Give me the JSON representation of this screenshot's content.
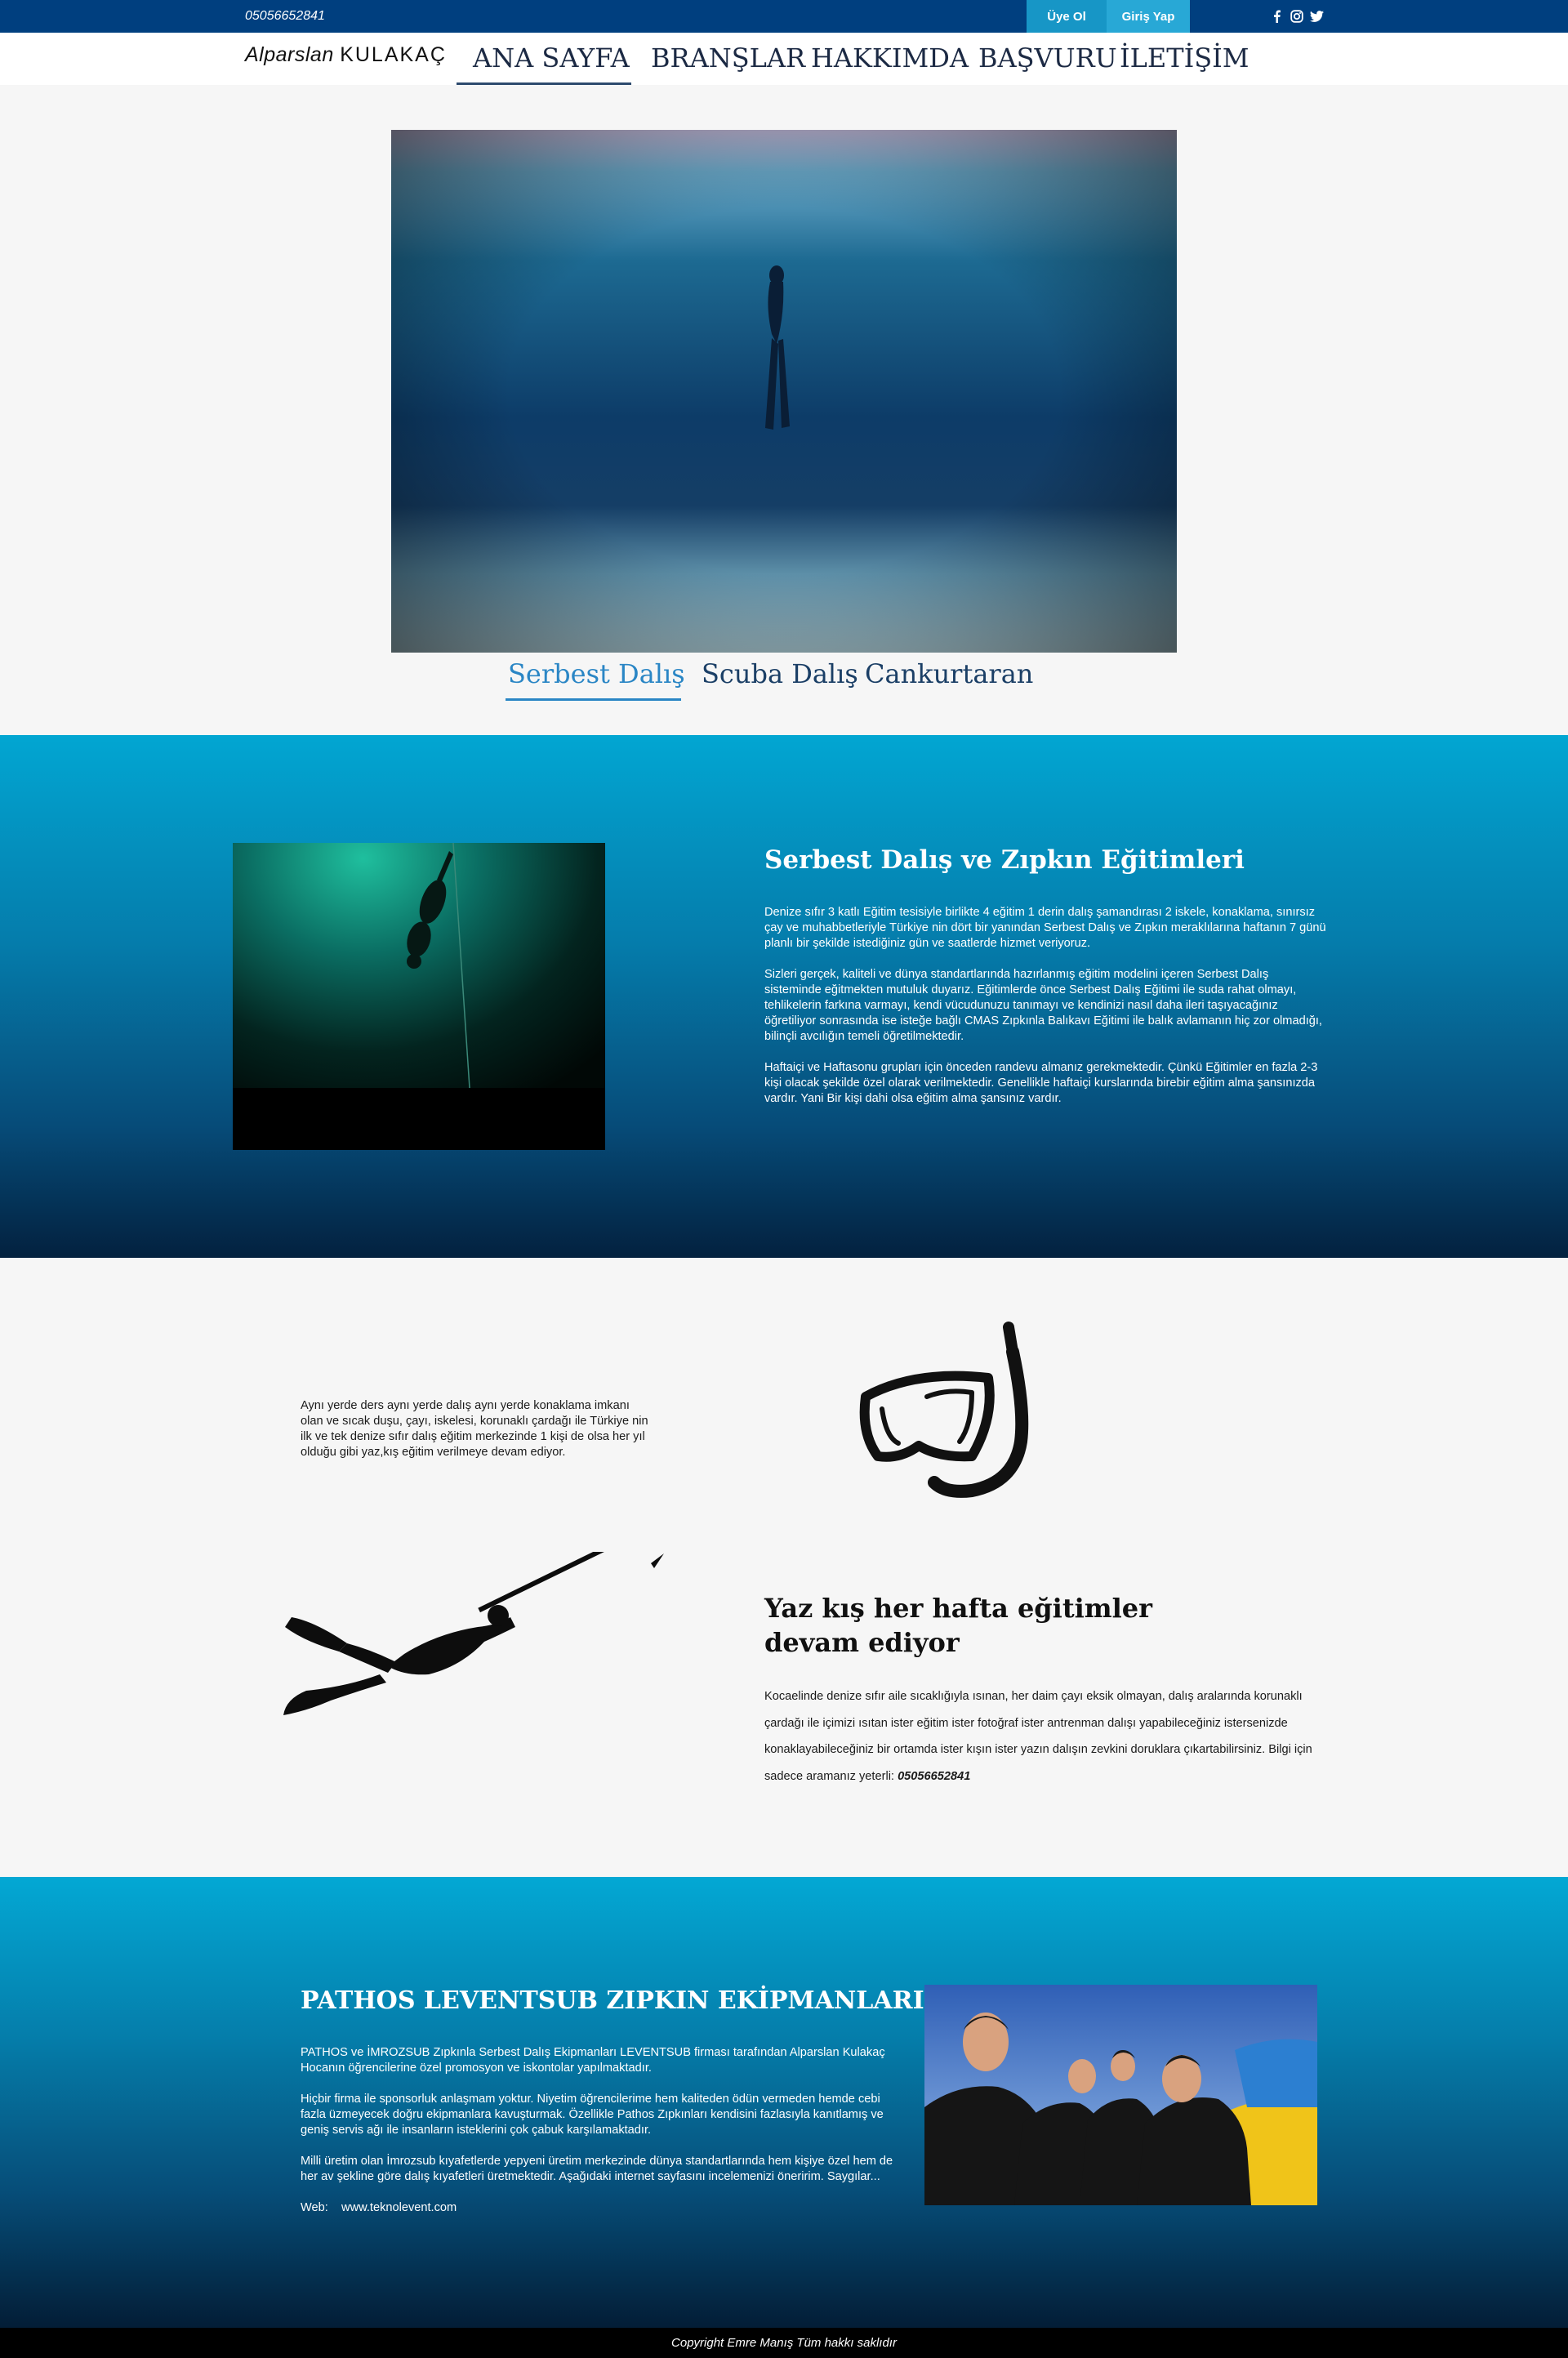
{
  "topbar": {
    "phone": "05056652841",
    "signup_label": "Üye Ol",
    "login_label": "Giriş Yap",
    "social": [
      "facebook-icon",
      "instagram-icon",
      "twitter-icon"
    ]
  },
  "nav": {
    "logo_first": "Alparslan",
    "logo_last": "KULAKAÇ",
    "items": [
      "ANA SAYFA",
      "BRANŞLAR",
      "HAKKIMDA",
      "BAŞVURU",
      "İLETİŞİM"
    ],
    "active": "ANA SAYFA"
  },
  "tabs": {
    "items": [
      "Serbest Dalış",
      "Scuba Dalış",
      "Cankurtaran"
    ],
    "active": "Serbest Dalış"
  },
  "section1": {
    "title": "Serbest Dalış ve Zıpkın Eğitimleri",
    "p1": "Denize sıfır 3 katlı Eğitim tesisiyle birlikte 4 eğitim 1 derin dalış şamandırası 2 iskele, konaklama, sınırsız çay ve muhabbetleriyle Türkiye nin dört bir yanından Serbest Dalış ve Zıpkın meraklılarına haftanın 7 günü planlı bir şekilde istediğiniz gün ve saatlerde hizmet veriyoruz.",
    "p2": "Sizleri gerçek, kaliteli ve dünya standartlarında hazırlanmış eğitim modelini içeren Serbest Dalış sisteminde eğitmekten mutuluk duyarız. Eğitimlerde önce Serbest Dalış  Eğitimi ile suda rahat olmayı, tehlikelerin farkına varmayı, kendi vücudunuzu tanımayı ve kendinizi nasıl daha ileri taşıyacağınız öğretiliyor sonrasında ise  isteğe bağlı CMAS Zıpkınla Balıkavı Eğitimi ile balık avlamanın hiç zor olmadığı, bilinçli avcılığın temeli öğretilmektedir.",
    "p3": "Haftaiçi ve Haftasonu grupları için önceden randevu almanız gerekmektedir. Çünkü Eğitimler en fazla 2-3 kişi olacak şekilde özel olarak verilmektedir. Genellikle haftaiçi kurslarında birebir eğitim alma şansınızda vardır. Yani Bir kişi dahi olsa eğitim alma şansınız vardır."
  },
  "section2": {
    "intro": "Aynı yerde ders aynı yerde dalış aynı yerde konaklama imkanı olan ve sıcak duşu, çayı, iskelesi, korunaklı çardağı ile Türkiye nin ilk ve tek denize sıfır dalış eğitim merkezinde 1 kişi de olsa her yıl olduğu gibi yaz,kış eğitim verilmeye devam ediyor.",
    "title_line1": "Yaz kış her hafta eğitimler",
    "title_line2": "devam ediyor",
    "body": "Kocaelinde denize sıfır aile sıcaklığıyla ısınan, her daim çayı eksik olmayan, dalış aralarında korunaklı çardağı ile içimizi ısıtan ister eğitim ister fotoğraf ister antrenman dalışı yapabileceğiniz istersenizde konaklayabileceğiniz bir ortamda ister kışın ister yazın dalışın zevkini doruklara çıkartabilirsiniz. Bilgi için sadece aramanız yeterli:",
    "phone": "05056652841"
  },
  "section3": {
    "title": "PATHOS LEVENTSUB ZIPKIN EKİPMANLARI",
    "p1": "PATHOS ve İMROZSUB  Zıpkınla Serbest Dalış Ekipmanları LEVENTSUB firması tarafından Alparslan Kulakaç Hocanın öğrencilerine özel promosyon ve iskontolar yapılmaktadır.",
    "p2": "Hiçbir firma ile sponsorluk anlaşmam yoktur. Niyetim öğrencilerime hem kaliteden ödün vermeden hemde cebi fazla üzmeyecek doğru ekipmanlara kavuşturmak. Özellikle Pathos Zıpkınları kendisini fazlasıyla kanıtlamış ve geniş servis ağı ile insanların isteklerini çok çabuk karşılamaktadır.",
    "p3": "Milli üretim olan İmrozsub kıyafetlerde yepyeni üretim merkezinde dünya standartlarında hem kişiye özel hem de her av şekline göre dalış kıyafetleri üretmektedir. Aşağıdaki internet sayfasını incelemenizi öneririm. Saygılar...",
    "web_label": "Web:",
    "web_url": "www.teknolevent.com"
  },
  "footer": {
    "copyright": "Copyright Emre Manış Tüm hakkı saklıdır"
  },
  "colors": {
    "topbar": "#003f7f",
    "accent": "#2a86c5",
    "ocean_top": "#02a6d2",
    "ocean_bottom": "#03213f"
  }
}
